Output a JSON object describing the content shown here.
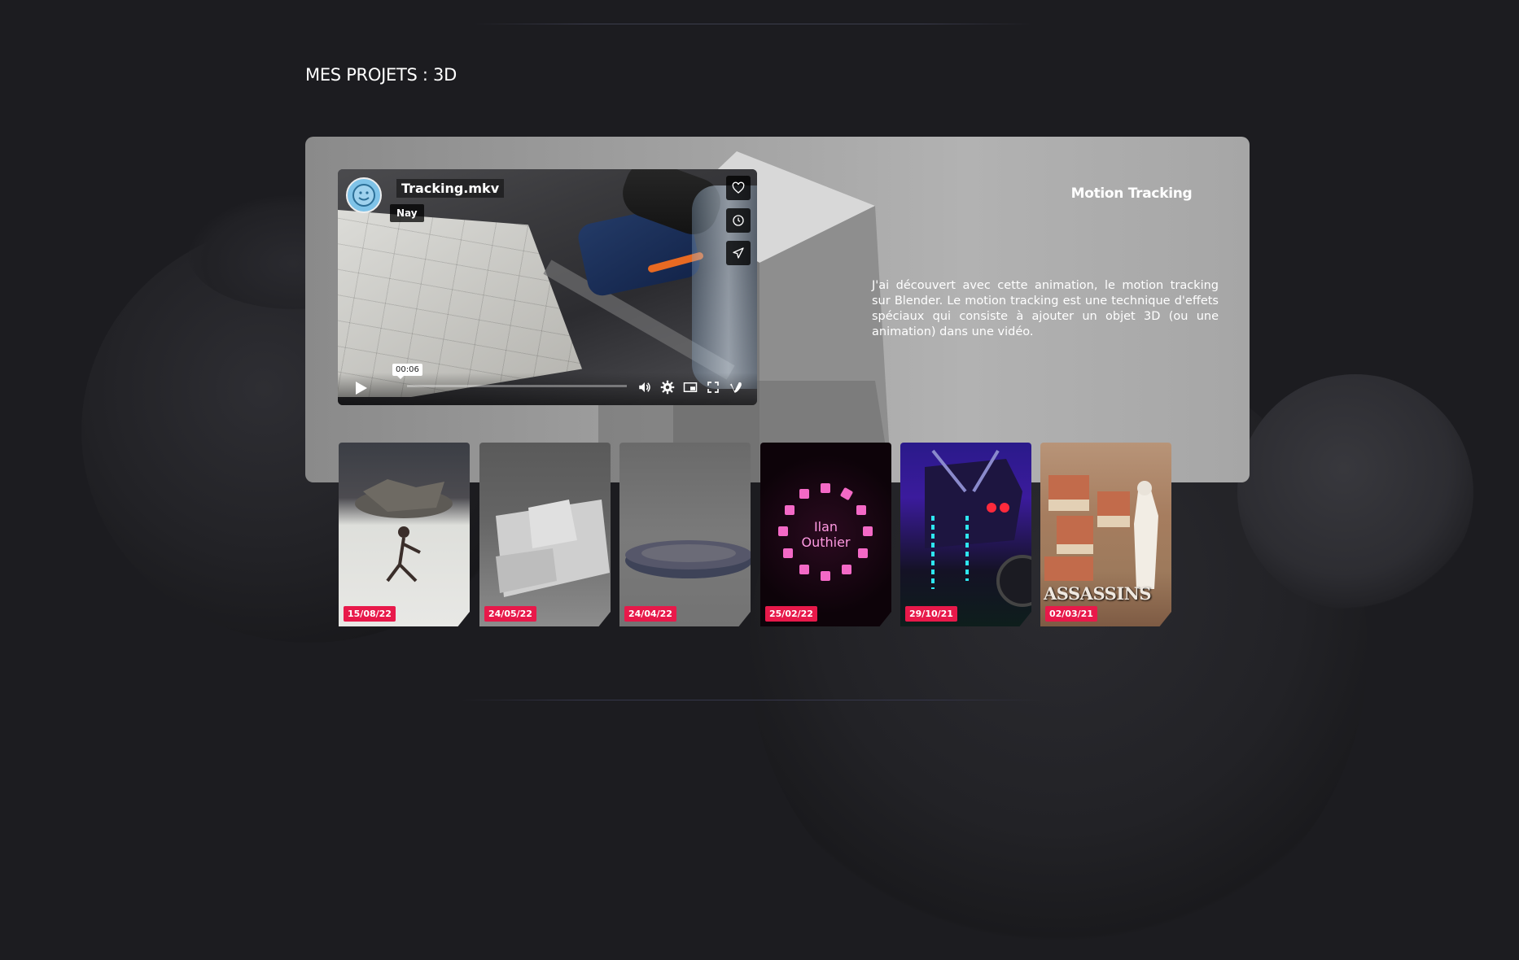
{
  "section": {
    "title": "MES PROJETS : 3D"
  },
  "video": {
    "title": "Tracking.mkv",
    "author": "Nay",
    "time": "00:06",
    "icons": [
      "heart-icon",
      "clock-icon",
      "send-icon",
      "play-icon",
      "volume-icon",
      "settings-icon",
      "pip-icon",
      "fullscreen-icon",
      "vimeo-icon"
    ]
  },
  "project": {
    "name": "Motion Tracking",
    "description": "J'ai découvert avec cette animation, le motion tracking sur Blender. Le motion tracking est une technique d'effets spéciaux qui consiste à ajouter un objet 3D (ou une animation) dans une vidéo."
  },
  "thumbnails": [
    {
      "date": "15/08/22"
    },
    {
      "date": "24/05/22"
    },
    {
      "date": "24/04/22"
    },
    {
      "date": "25/02/22",
      "label_line1": "Ilan",
      "label_line2": "Outhier"
    },
    {
      "date": "29/10/21"
    },
    {
      "date": "02/03/21",
      "logo": "ASSASSINS"
    }
  ],
  "colors": {
    "date_badge": "#e8194a",
    "background": "#1c1c20"
  }
}
